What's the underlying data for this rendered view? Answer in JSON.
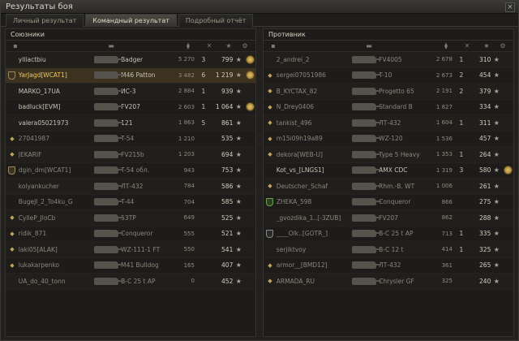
{
  "window": {
    "title": "Результаты боя",
    "close_label": "×"
  },
  "tabs": [
    {
      "label": "Личный результат",
      "active": false
    },
    {
      "label": "Командный результат",
      "active": true
    },
    {
      "label": "Подробный отчёт",
      "active": false
    }
  ],
  "allies": {
    "title": "Союзники",
    "rows": [
      {
        "icon": "",
        "name": "ylliactbiu",
        "tank": "Badger",
        "damage": "5 270",
        "kills": "3",
        "xp": "799",
        "medal": true,
        "me": false,
        "dead": false
      },
      {
        "icon": "clan",
        "name": "YarJagd[WCAT1]",
        "tank": "M46 Patton",
        "damage": "3 482",
        "kills": "6",
        "xp": "1 219",
        "medal": true,
        "me": true,
        "dead": false
      },
      {
        "icon": "",
        "name": "MARKO_17UA",
        "tank": "ИС-3",
        "damage": "2 884",
        "kills": "1",
        "xp": "939",
        "medal": false,
        "me": false,
        "dead": false
      },
      {
        "icon": "",
        "name": "badluck[EVM]",
        "tank": "FV207",
        "damage": "2 603",
        "kills": "1",
        "xp": "1 064",
        "medal": true,
        "me": false,
        "dead": false
      },
      {
        "icon": "",
        "name": "valera05021973",
        "tank": "121",
        "damage": "1 863",
        "kills": "5",
        "xp": "861",
        "medal": false,
        "me": false,
        "dead": false
      },
      {
        "icon": "platoon",
        "name": "27041987",
        "tank": "T-54",
        "damage": "1 210",
        "kills": "",
        "xp": "535",
        "medal": false,
        "me": false,
        "dead": true
      },
      {
        "icon": "platoon",
        "name": "JEKARIF",
        "tank": "FV215b",
        "damage": "1 203",
        "kills": "",
        "xp": "694",
        "medal": false,
        "me": false,
        "dead": true
      },
      {
        "icon": "clan",
        "name": "dgin_dm[WCAT1]",
        "tank": "T-54 обл.",
        "damage": "943",
        "kills": "",
        "xp": "753",
        "medal": false,
        "me": false,
        "dead": true
      },
      {
        "icon": "",
        "name": "kolyankucher",
        "tank": "ЛТ-432",
        "damage": "784",
        "kills": "",
        "xp": "586",
        "medal": false,
        "me": false,
        "dead": true
      },
      {
        "icon": "",
        "name": "BugeJl_2_To4ku_G",
        "tank": "T-44",
        "damage": "704",
        "kills": "",
        "xp": "585",
        "medal": false,
        "me": false,
        "dead": true
      },
      {
        "icon": "platoon",
        "name": "CylleP_JloCb",
        "tank": "53TP",
        "damage": "649",
        "kills": "",
        "xp": "525",
        "medal": false,
        "me": false,
        "dead": true
      },
      {
        "icon": "platoon",
        "name": "ridik_871",
        "tank": "Conqueror",
        "damage": "555",
        "kills": "",
        "xp": "521",
        "medal": false,
        "me": false,
        "dead": true
      },
      {
        "icon": "platoon",
        "name": "laki05[ALAK]",
        "tank": "WZ-111-1 FT",
        "damage": "550",
        "kills": "",
        "xp": "541",
        "medal": false,
        "me": false,
        "dead": true
      },
      {
        "icon": "platoon",
        "name": "lukakarpenko",
        "tank": "M41 Bulldog",
        "damage": "165",
        "kills": "",
        "xp": "407",
        "medal": false,
        "me": false,
        "dead": true
      },
      {
        "icon": "",
        "name": "UA_do_40_tonn",
        "tank": "B-C 25 t AP",
        "damage": "0",
        "kills": "",
        "xp": "452",
        "medal": false,
        "me": false,
        "dead": true
      }
    ]
  },
  "enemies": {
    "title": "Противник",
    "rows": [
      {
        "icon": "",
        "name": "2_andrei_2",
        "tank": "FV4005",
        "damage": "2 678",
        "kills": "1",
        "xp": "310",
        "medal": false,
        "dead": true
      },
      {
        "icon": "platoon",
        "name": "sergei07051986",
        "tank": "T-10",
        "damage": "2 673",
        "kills": "2",
        "xp": "454",
        "medal": false,
        "dead": true
      },
      {
        "icon": "platoon",
        "name": "B_KYCTAX_82",
        "tank": "Progetto 65",
        "damage": "2 191",
        "kills": "2",
        "xp": "379",
        "medal": false,
        "dead": true
      },
      {
        "icon": "platoon",
        "name": "N_Drey0406",
        "tank": "Standard B",
        "damage": "1 827",
        "kills": "",
        "xp": "334",
        "medal": false,
        "dead": true
      },
      {
        "icon": "platoon",
        "name": "tankist_496",
        "tank": "ЛТ-432",
        "damage": "1 604",
        "kills": "1",
        "xp": "311",
        "medal": false,
        "dead": true
      },
      {
        "icon": "platoon",
        "name": "m15i09h19a89",
        "tank": "WZ-120",
        "damage": "1 536",
        "kills": "",
        "xp": "457",
        "medal": false,
        "dead": true
      },
      {
        "icon": "platoon",
        "name": "dekora[WEB-U]",
        "tank": "Type 5 Heavy",
        "damage": "1 353",
        "kills": "1",
        "xp": "264",
        "medal": false,
        "dead": true
      },
      {
        "icon": "",
        "name": "Kot_vs_[LNGS1]",
        "tank": "AMX CDC",
        "damage": "1 319",
        "kills": "3",
        "xp": "580",
        "medal": true,
        "dead": false
      },
      {
        "icon": "platoon",
        "name": "Deutscher_Schaf",
        "tank": "Rhm.-B. WT",
        "damage": "1 006",
        "kills": "",
        "xp": "261",
        "medal": false,
        "dead": true
      },
      {
        "icon": "green",
        "name": "ZHEKA_598",
        "tank": "Conqueror",
        "damage": "866",
        "kills": "",
        "xp": "275",
        "medal": false,
        "dead": true
      },
      {
        "icon": "",
        "name": "_gvozdika_1..[-3ZUB]",
        "tank": "FV207",
        "damage": "862",
        "kills": "",
        "xp": "288",
        "medal": false,
        "dead": true
      },
      {
        "icon": "grey",
        "name": "____Olk..[GOTR_]",
        "tank": "B-C 25 t AP",
        "damage": "713",
        "kills": "1",
        "xp": "335",
        "medal": false,
        "dead": true
      },
      {
        "icon": "",
        "name": "serjiktvoy",
        "tank": "B-C 12 t",
        "damage": "414",
        "kills": "1",
        "xp": "325",
        "medal": false,
        "dead": true
      },
      {
        "icon": "platoon",
        "name": "armor__[BMD12]",
        "tank": "ЛТ-432",
        "damage": "361",
        "kills": "",
        "xp": "265",
        "medal": false,
        "dead": true
      },
      {
        "icon": "platoon",
        "name": "ARMADA_RU",
        "tank": "Chrysler GF",
        "damage": "325",
        "kills": "",
        "xp": "240",
        "medal": false,
        "dead": true
      }
    ]
  },
  "column_icons": {
    "tank": "tank-icon",
    "damage": "damage-icon",
    "kills": "kills-icon",
    "xp": "star-icon"
  },
  "star_glyph": "★"
}
